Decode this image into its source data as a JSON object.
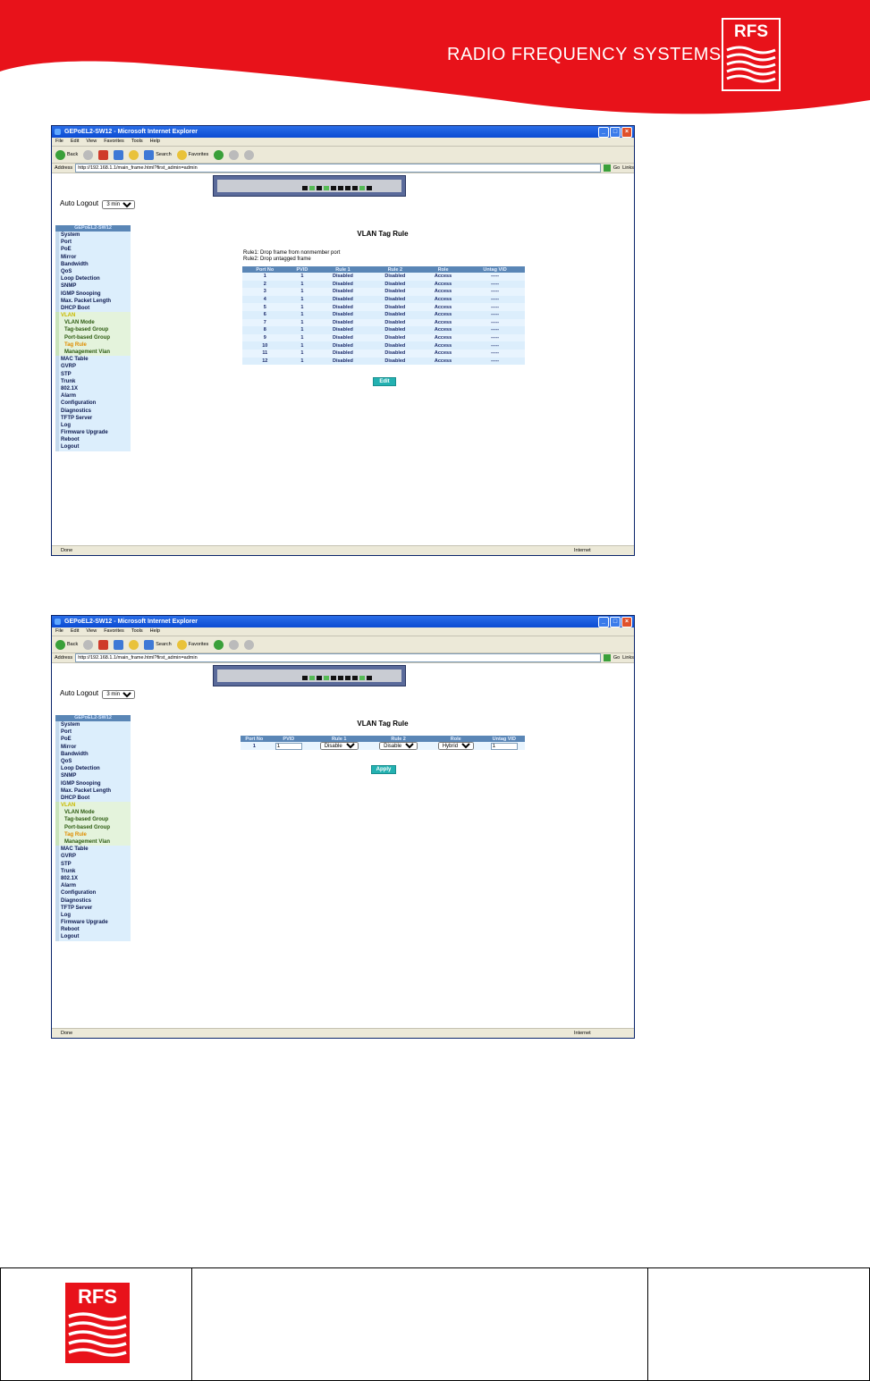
{
  "header": {
    "brand_text": "RADIO FREQUENCY SYSTEMS",
    "logo_text": "RFS",
    "colors": {
      "red": "#e8121a"
    }
  },
  "footer": {
    "logo_text": "RFS"
  },
  "browser": {
    "title": "GEPoEL2-SW12 - Microsoft Internet Explorer",
    "menu": [
      "File",
      "Edit",
      "View",
      "Favorites",
      "Tools",
      "Help"
    ],
    "toolbar": {
      "back": "Back",
      "search": "Search",
      "favorites": "Favorites"
    },
    "address_label": "Address",
    "address": "http://192.168.1.1/main_frame.html?first_admin=admin",
    "go_label": "Go",
    "links_label": "Links",
    "status": "Done",
    "zone": "Internet"
  },
  "auto_logout": {
    "label": "Auto Logout",
    "value": "3 min"
  },
  "sidebar": {
    "heading": "GEPoEL2-SW12",
    "items": [
      "System",
      "Port",
      "PoE",
      "Mirror",
      "Bandwidth",
      "QoS",
      "Loop Detection",
      "SNMP",
      "IGMP Snooping",
      "Max. Packet Length",
      "DHCP Boot",
      "VLAN",
      "VLAN Mode",
      "Tag-based Group",
      "Port-based Group",
      "Tag Rule",
      "Management Vlan",
      "MAC Table",
      "GVRP",
      "STP",
      "Trunk",
      "802.1X",
      "Alarm",
      "Configuration",
      "Diagnostics",
      "TFTP Server",
      "Log",
      "Firmware Upgrade",
      "Reboot",
      "Logout"
    ]
  },
  "screen1": {
    "title": "VLAN Tag Rule",
    "rule1": "Rule1: Drop frame from nonmember port",
    "rule2": "Rule2: Drop untagged frame",
    "columns": [
      "Port No",
      "PVID",
      "Rule 1",
      "Rule 2",
      "Role",
      "Untag VID"
    ],
    "rows": [
      [
        "1",
        "1",
        "Disabled",
        "Disabled",
        "Access",
        "-----"
      ],
      [
        "2",
        "1",
        "Disabled",
        "Disabled",
        "Access",
        "-----"
      ],
      [
        "3",
        "1",
        "Disabled",
        "Disabled",
        "Access",
        "-----"
      ],
      [
        "4",
        "1",
        "Disabled",
        "Disabled",
        "Access",
        "-----"
      ],
      [
        "5",
        "1",
        "Disabled",
        "Disabled",
        "Access",
        "-----"
      ],
      [
        "6",
        "1",
        "Disabled",
        "Disabled",
        "Access",
        "-----"
      ],
      [
        "7",
        "1",
        "Disabled",
        "Disabled",
        "Access",
        "-----"
      ],
      [
        "8",
        "1",
        "Disabled",
        "Disabled",
        "Access",
        "-----"
      ],
      [
        "9",
        "1",
        "Disabled",
        "Disabled",
        "Access",
        "-----"
      ],
      [
        "10",
        "1",
        "Disabled",
        "Disabled",
        "Access",
        "-----"
      ],
      [
        "11",
        "1",
        "Disabled",
        "Disabled",
        "Access",
        "-----"
      ],
      [
        "12",
        "1",
        "Disabled",
        "Disabled",
        "Access",
        "-----"
      ]
    ],
    "button": "Edit"
  },
  "screen2": {
    "title": "VLAN Tag Rule",
    "columns": [
      "Port No",
      "PVID",
      "Rule 1",
      "Rule 2",
      "Role",
      "Untag VID"
    ],
    "row": {
      "port": "1",
      "pvid": "1",
      "rule1": "Disable",
      "rule2": "Disable",
      "role": "Hybrid",
      "untag_vid": "1"
    },
    "button": "Apply"
  }
}
